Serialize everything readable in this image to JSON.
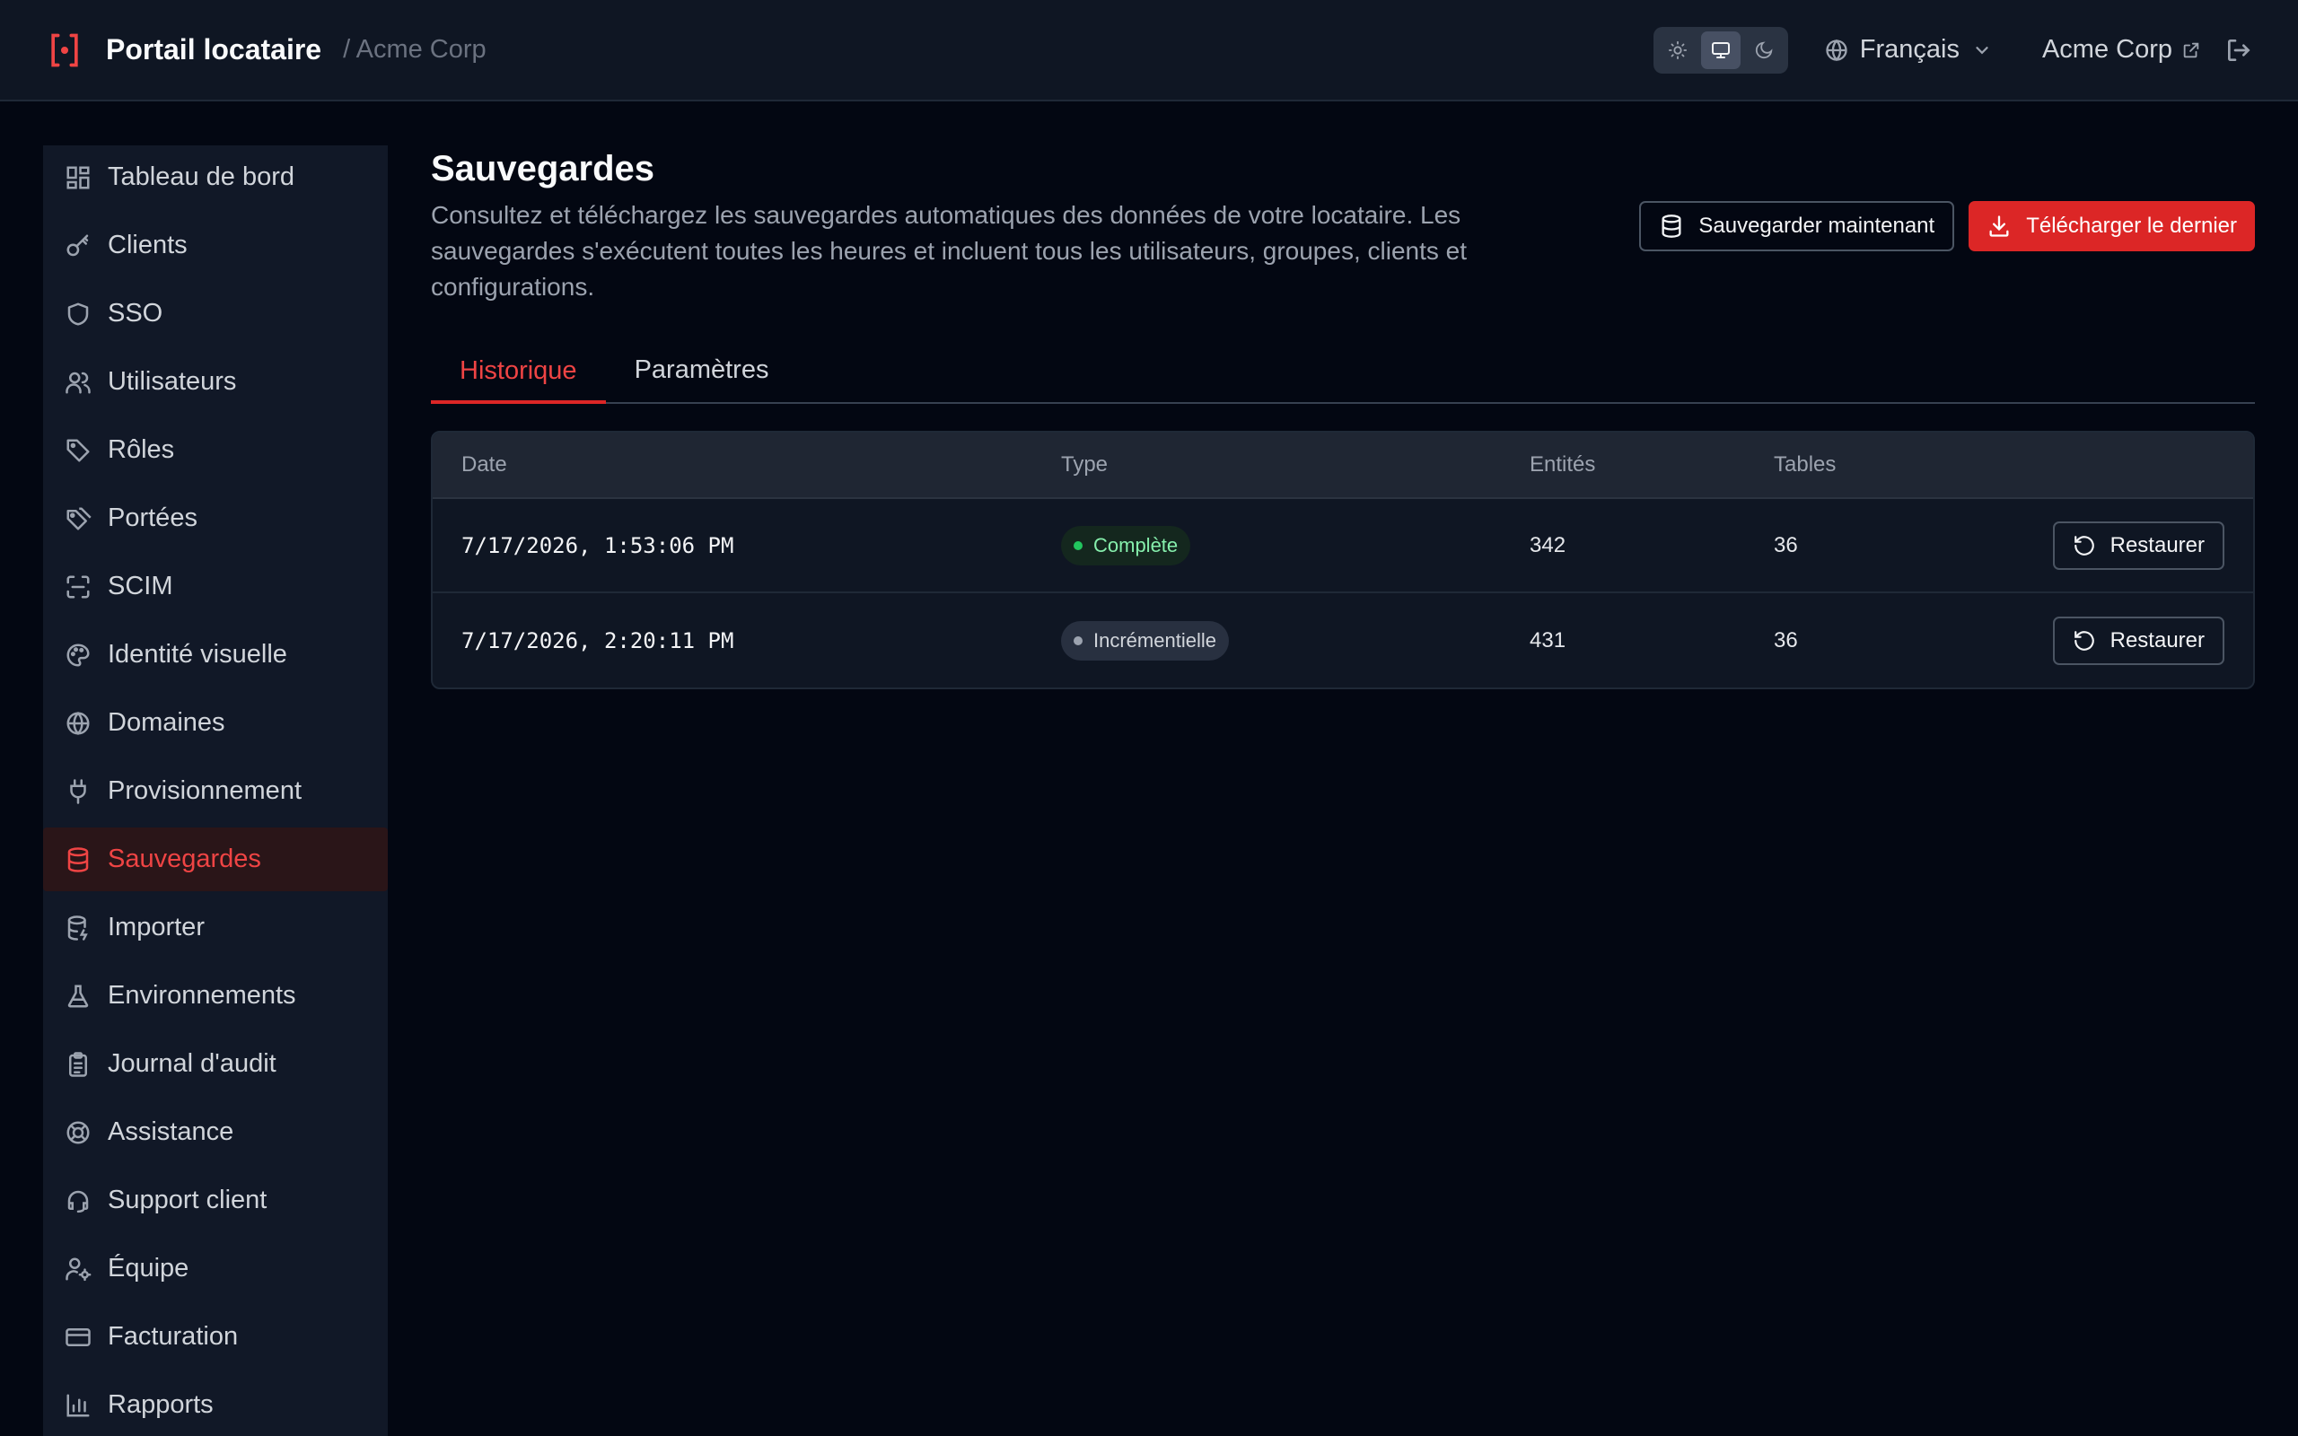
{
  "header": {
    "title": "Portail locataire",
    "subtitle": "/ Acme Corp",
    "language": "Français",
    "org_link": "Acme Corp",
    "theme_modes": [
      "sun-icon",
      "monitor-icon",
      "moon-icon"
    ],
    "active_theme": "monitor-icon"
  },
  "sidebar": {
    "items": [
      {
        "label": "Tableau de bord",
        "icon": "dashboard-icon"
      },
      {
        "label": "Clients",
        "icon": "key-icon"
      },
      {
        "label": "SSO",
        "icon": "shield-icon"
      },
      {
        "label": "Utilisateurs",
        "icon": "users-icon"
      },
      {
        "label": "Rôles",
        "icon": "tag-icon"
      },
      {
        "label": "Portées",
        "icon": "tags-icon"
      },
      {
        "label": "SCIM",
        "icon": "scan-icon"
      },
      {
        "label": "Identité visuelle",
        "icon": "palette-icon"
      },
      {
        "label": "Domaines",
        "icon": "globe-icon"
      },
      {
        "label": "Provisionnement",
        "icon": "plug-icon"
      },
      {
        "label": "Sauvegardes",
        "icon": "database-icon"
      },
      {
        "label": "Importer",
        "icon": "database-import-icon"
      },
      {
        "label": "Environnements",
        "icon": "flask-icon"
      },
      {
        "label": "Journal d'audit",
        "icon": "clipboard-icon"
      },
      {
        "label": "Assistance",
        "icon": "lifebuoy-icon"
      },
      {
        "label": "Support client",
        "icon": "headset-icon"
      },
      {
        "label": "Équipe",
        "icon": "user-cog-icon"
      },
      {
        "label": "Facturation",
        "icon": "credit-card-icon"
      },
      {
        "label": "Rapports",
        "icon": "bar-chart-icon"
      }
    ],
    "active": "Sauvegardes"
  },
  "main": {
    "title": "Sauvegardes",
    "description": "Consultez et téléchargez les sauvegardes automatiques des données de votre locataire. Les sauvegardes s'exécutent toutes les heures et incluent tous les utilisateurs, groupes, clients et configurations.",
    "backup_now_label": "Sauvegarder maintenant",
    "download_latest_label": "Télécharger le dernier",
    "tabs": [
      {
        "label": "Historique",
        "active": true
      },
      {
        "label": "Paramètres",
        "active": false
      }
    ],
    "table": {
      "columns": [
        "Date",
        "Type",
        "Entités",
        "Tables",
        ""
      ],
      "rows": [
        {
          "date": "7/17/2026, 1:53:06 PM",
          "type": "Complète",
          "type_kind": "full",
          "entities": "342",
          "tables": "36",
          "action": "Restaurer"
        },
        {
          "date": "7/17/2026, 2:20:11 PM",
          "type": "Incrémentielle",
          "type_kind": "incremental",
          "entities": "431",
          "tables": "36",
          "action": "Restaurer"
        }
      ]
    }
  },
  "colors": {
    "accent": "#dc2626",
    "background": "#030712",
    "surface": "#0f1623",
    "success": "#22c55e"
  }
}
